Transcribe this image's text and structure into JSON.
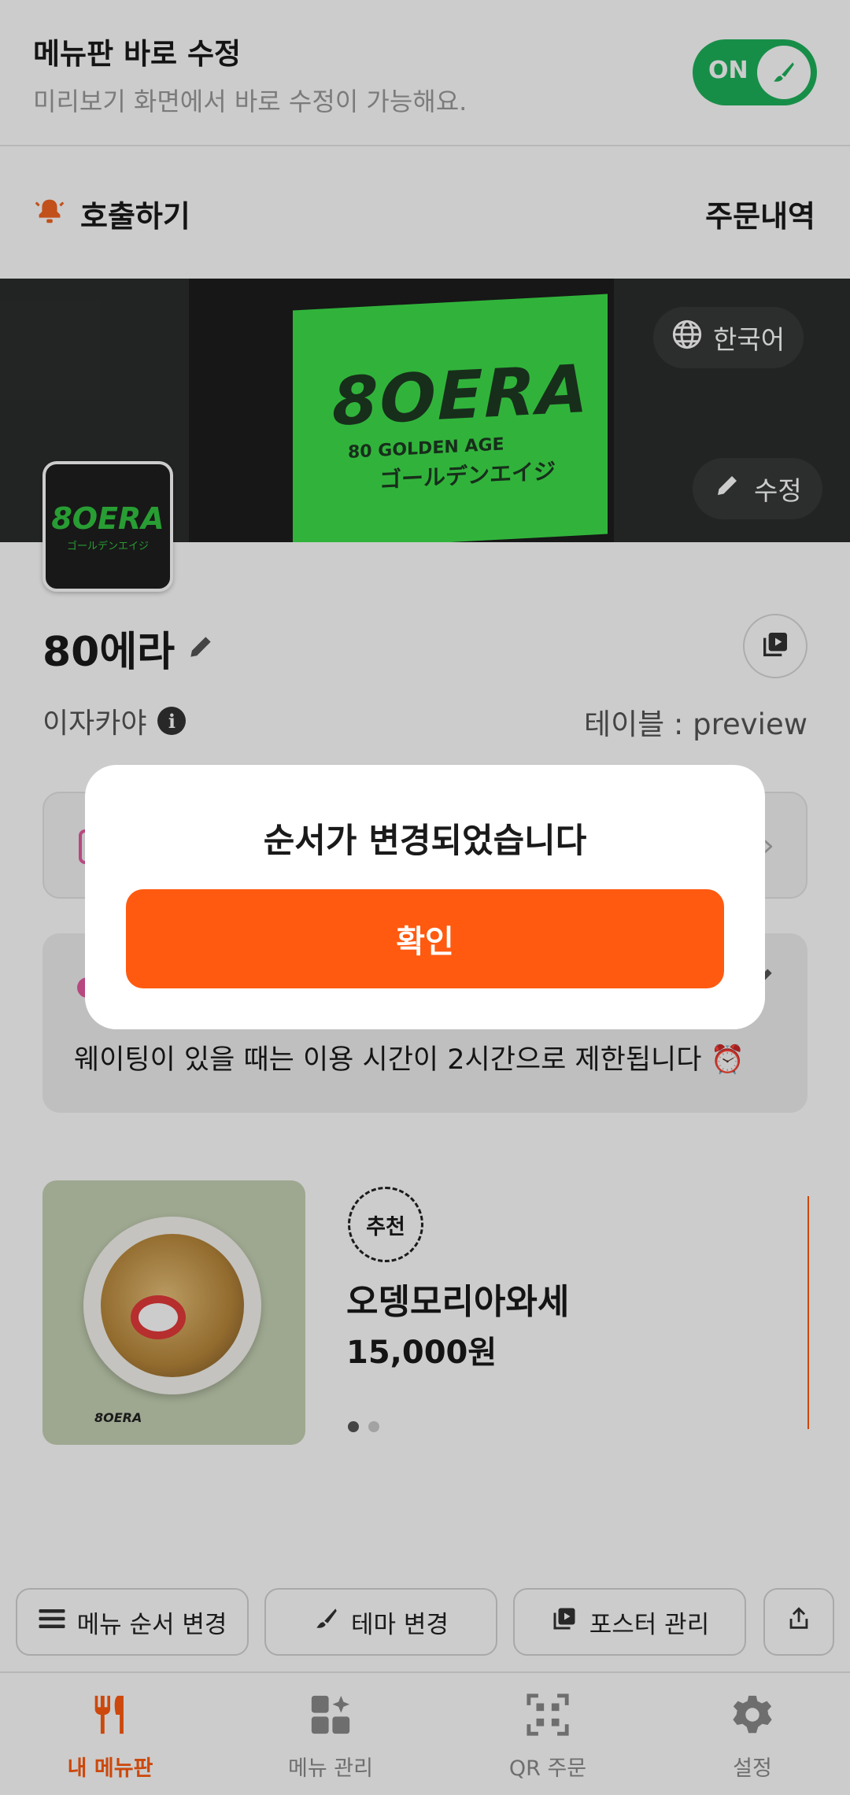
{
  "edit_mode": {
    "title": "메뉴판 바로 수정",
    "subtitle": "미리보기 화면에서 바로 수정이 가능해요.",
    "toggle_label": "ON"
  },
  "call_bar": {
    "call_label": "호출하기",
    "orders_label": "주문내역"
  },
  "banner": {
    "sign_logo": "8OERA",
    "sign_text": "80 GOLDEN AGE",
    "sign_jp": "ゴールデンエイジ",
    "language_label": "한국어",
    "edit_label": "수정"
  },
  "store": {
    "logo_text": "8OERA",
    "logo_sub": "ゴールデンエイジ",
    "name": "80에라",
    "category": "이자카야",
    "info_glyph": "i",
    "table_label": "테이블 : preview"
  },
  "notice": {
    "text": "웨이팅이 있을 때는 이용 시간이 2시간으로 제한됩니다 ⏰"
  },
  "menu_item": {
    "badge": "추천",
    "name": "오뎅모리아와세",
    "price": "15,000원",
    "image_brand": "8OERA"
  },
  "action_bar": {
    "reorder_label": "메뉴 순서 변경",
    "theme_label": "테마 변경",
    "poster_label": "포스터 관리"
  },
  "tabs": [
    {
      "label": "내 메뉴판",
      "icon": "fork-knife-icon",
      "active": true
    },
    {
      "label": "메뉴 관리",
      "icon": "grid-sparkle-icon",
      "active": false
    },
    {
      "label": "QR 주문",
      "icon": "qr-icon",
      "active": false
    },
    {
      "label": "설정",
      "icon": "gear-icon",
      "active": false
    }
  ],
  "modal": {
    "message": "순서가 변경되었습니다",
    "confirm_label": "확인"
  },
  "colors": {
    "accent": "#ff5a10",
    "toggle_on": "#1db25a",
    "sign_green": "#3ee04a"
  }
}
